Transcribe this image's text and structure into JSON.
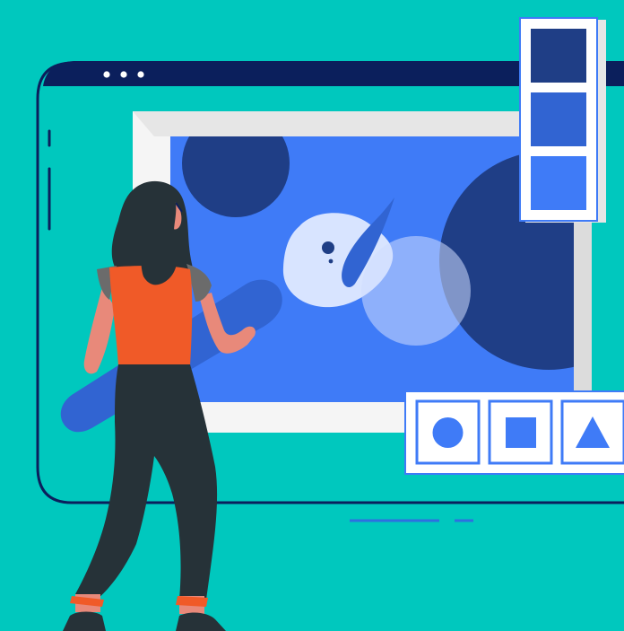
{
  "colors": {
    "background": "#00C8BE",
    "browser_frame": "#0B1F5C",
    "canvas_paper": "#3F7BF7",
    "canvas_border": "#E6E6E6",
    "dark_blue": "#1F3E86",
    "mid_blue": "#3164D2",
    "bright_blue": "#3F7BF7",
    "pale_blue": "#D8E4FF",
    "skin": "#E8897A",
    "shirt": "#F05A28",
    "hair_and_pants": "#263238",
    "sleeve_gray": "#6B6B6B",
    "shoe_accent": "#F05A28"
  },
  "window": {
    "control_dots": 3
  },
  "swatch_palette": {
    "swatches": [
      "#1F3E86",
      "#3164D2",
      "#3F7BF7"
    ]
  },
  "shape_toolbar": {
    "tools": [
      "circle-tool",
      "square-tool",
      "triangle-tool"
    ]
  },
  "icons": [
    "circle-icon",
    "square-icon",
    "triangle-icon",
    "window-control-dot-icon"
  ]
}
